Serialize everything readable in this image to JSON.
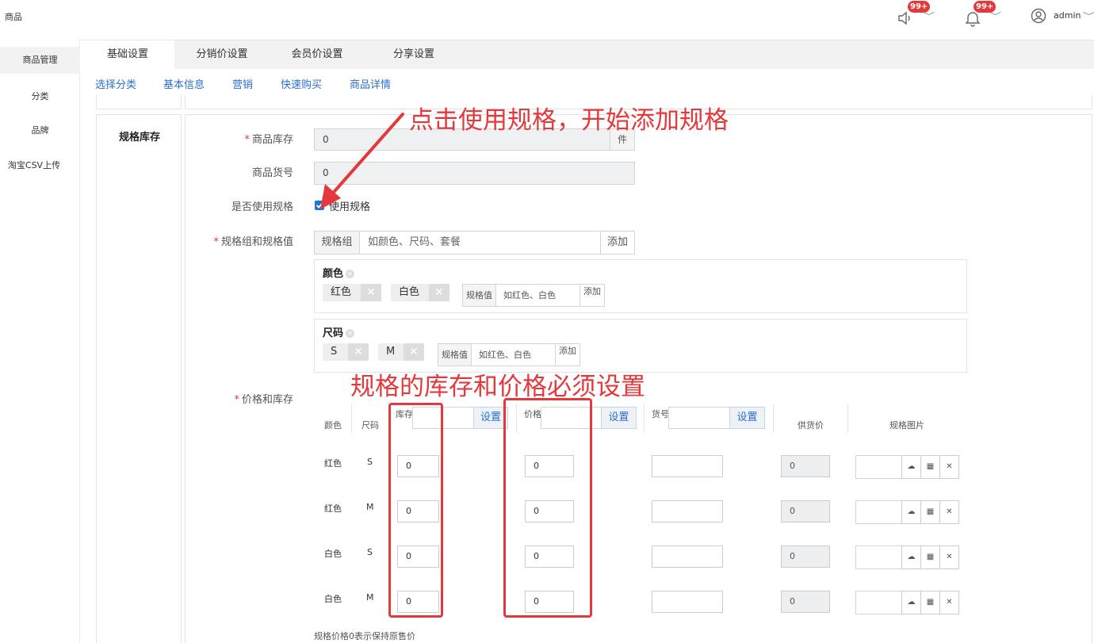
{
  "header": {
    "app_title": "商品",
    "notifications": [
      {
        "icon": "speaker-icon",
        "badge": "99+"
      },
      {
        "icon": "bell-icon",
        "badge": "99+"
      }
    ],
    "user": {
      "icon": "user-circle-icon",
      "name": "admin"
    }
  },
  "sidebar": {
    "items": [
      {
        "label": "商品管理",
        "active": true
      },
      {
        "label": "分类",
        "active": false
      },
      {
        "label": "品牌",
        "active": false
      },
      {
        "label": "淘宝CSV上传",
        "active": false
      }
    ]
  },
  "tabs": [
    {
      "label": "基础设置",
      "active": true
    },
    {
      "label": "分销价设置",
      "active": false
    },
    {
      "label": "会员价设置",
      "active": false
    },
    {
      "label": "分享设置",
      "active": false
    }
  ],
  "subnav": [
    "选择分类",
    "基本信息",
    "营销",
    "快速购买",
    "商品详情"
  ],
  "section": {
    "title": "规格库存"
  },
  "form": {
    "stock": {
      "label": "商品库存",
      "value": "0",
      "unit": "件"
    },
    "sku_no": {
      "label": "商品货号",
      "value": "0"
    },
    "use_spec": {
      "label": "是否使用规格",
      "checkbox_label": "使用规格",
      "checked": true
    },
    "spec_group": {
      "label": "规格组和规格值",
      "addon": "规格组",
      "placeholder": "如颜色、尺码、套餐",
      "add_label": "添加"
    },
    "groups": [
      {
        "name": "颜色",
        "values": [
          "红色",
          "白色"
        ],
        "addon": "规格值",
        "placeholder": "如红色、白色",
        "add_label": "添加"
      },
      {
        "name": "尺码",
        "values": [
          "S",
          "M"
        ],
        "addon": "规格值",
        "placeholder": "如红色、白色",
        "add_label": "添加"
      }
    ],
    "price_stock": {
      "label": "价格和库存",
      "columns": {
        "color": "颜色",
        "size": "尺码",
        "stock": "库存",
        "price": "价格",
        "code": "货号",
        "supply": "供货价",
        "image": "规格图片"
      },
      "set_label": "设置",
      "rows": [
        {
          "color": "红色",
          "size": "S",
          "stock": "0",
          "price": "0",
          "code": "",
          "supply": "0"
        },
        {
          "color": "红色",
          "size": "M",
          "stock": "0",
          "price": "0",
          "code": "",
          "supply": "0"
        },
        {
          "color": "白色",
          "size": "S",
          "stock": "0",
          "price": "0",
          "code": "",
          "supply": "0"
        },
        {
          "color": "白色",
          "size": "M",
          "stock": "0",
          "price": "0",
          "code": "",
          "supply": "0"
        }
      ],
      "footnote": "规格价格0表示保持原售价"
    }
  },
  "annotations": {
    "top": "点击使用规格，开始添加规格",
    "middle": "规格的库存和价格必须设置"
  },
  "colors": {
    "accent": "#2a6fd2",
    "annotation": "#e4393c",
    "badge": "#e4393c"
  }
}
